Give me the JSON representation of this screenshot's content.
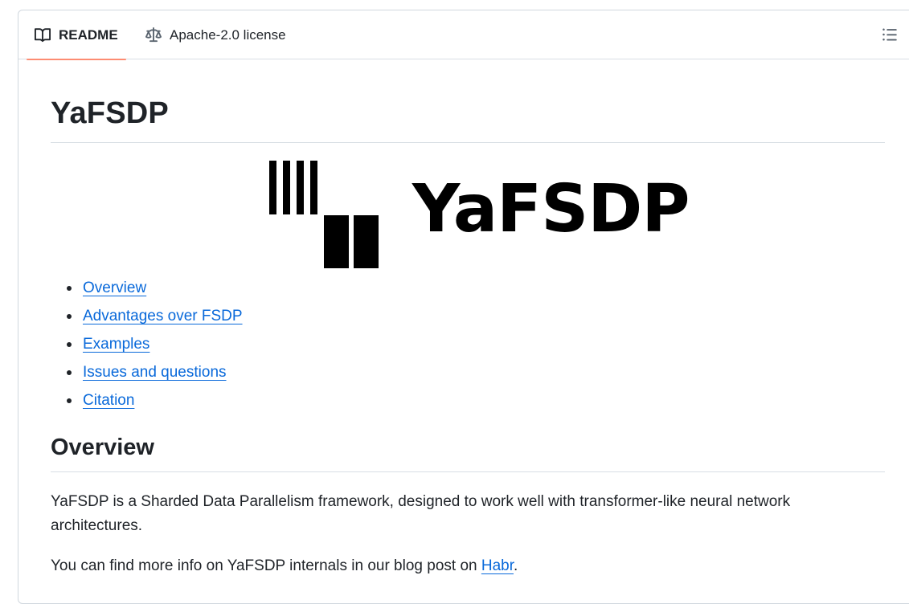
{
  "tabs": [
    {
      "label": "README",
      "icon": "book-icon",
      "active": true
    },
    {
      "label": "Apache-2.0 license",
      "icon": "scale-icon",
      "active": false
    }
  ],
  "outline_icon": "list-icon",
  "readme": {
    "title": "YaFSDP",
    "logo_text": "YaFSDP",
    "toc": [
      {
        "label": "Overview"
      },
      {
        "label": "Advantages over FSDP"
      },
      {
        "label": "Examples"
      },
      {
        "label": "Issues and questions"
      },
      {
        "label": "Citation"
      }
    ],
    "overview_heading": "Overview",
    "paragraph1": "YaFSDP is a Sharded Data Parallelism framework, designed to work well with transformer-like neural network architectures.",
    "paragraph2_prefix": "You can find more info on YaFSDP internals in our blog post on ",
    "paragraph2_link": "Habr",
    "paragraph2_suffix": "."
  },
  "colors": {
    "link": "#0969da",
    "active_tab_underline": "#fd8c73",
    "border": "#d0d7de",
    "text": "#1f2328"
  }
}
